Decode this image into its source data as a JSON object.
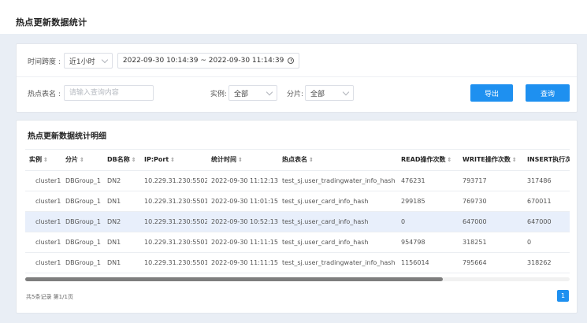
{
  "page": {
    "title": "热点更新数据统计"
  },
  "filters": {
    "time_label": "时间跨度 :",
    "time_select": "近1小时",
    "date_range": "2022-09-30 10:14:39 ~ 2022-09-30 11:14:39",
    "table_label": "热点表名 :",
    "table_placeholder": "请输入查询内容",
    "table_value": "",
    "instance_label": "实例:",
    "instance_select": "全部",
    "shard_label": "分片:",
    "shard_select": "全部",
    "export_label": "导出",
    "search_label": "查询"
  },
  "table": {
    "title": "热点更新数据统计明细",
    "columns": [
      "实例",
      "分片",
      "DB名称",
      "IP:Port",
      "统计时间",
      "热点表名",
      "READ操作次数",
      "WRITE操作次数",
      "INSERT执行次"
    ],
    "rows": [
      [
        "cluster1",
        "DBGroup_1",
        "DN2",
        "10.229.31.230:5502",
        "2022-09-30 11:12:13",
        "test_sj.user_tradingwater_info_hash",
        "476231",
        "793717",
        "317486"
      ],
      [
        "cluster1",
        "DBGroup_1",
        "DN1",
        "10.229.31.230:5501",
        "2022-09-30 11:01:15",
        "test_sj.user_card_info_hash",
        "299185",
        "769730",
        "670011"
      ],
      [
        "cluster1",
        "DBGroup_1",
        "DN2",
        "10.229.31.230:5502",
        "2022-09-30 10:52:13",
        "test_sj.user_card_info_hash",
        "0",
        "647000",
        "647000"
      ],
      [
        "cluster1",
        "DBGroup_1",
        "DN1",
        "10.229.31.230:5501",
        "2022-09-30 11:11:15",
        "test_sj.user_card_info_hash",
        "954798",
        "318251",
        "0"
      ],
      [
        "cluster1",
        "DBGroup_1",
        "DN1",
        "10.229.31.230:5501",
        "2022-09-30 11:11:15",
        "test_sj.user_tradingwater_info_hash",
        "1156014",
        "795664",
        "318262"
      ]
    ],
    "selected_row": 2
  },
  "pagination": {
    "summary": "共5条记录 第1/1页",
    "current_page": "1"
  },
  "colors": {
    "accent": "#1e90f0",
    "selected_row": "#e8effb",
    "background": "#e9eef5"
  },
  "icons": {
    "date_range": "clock-icon",
    "select": "chevron-down-icon",
    "sort": "sort-icon"
  }
}
